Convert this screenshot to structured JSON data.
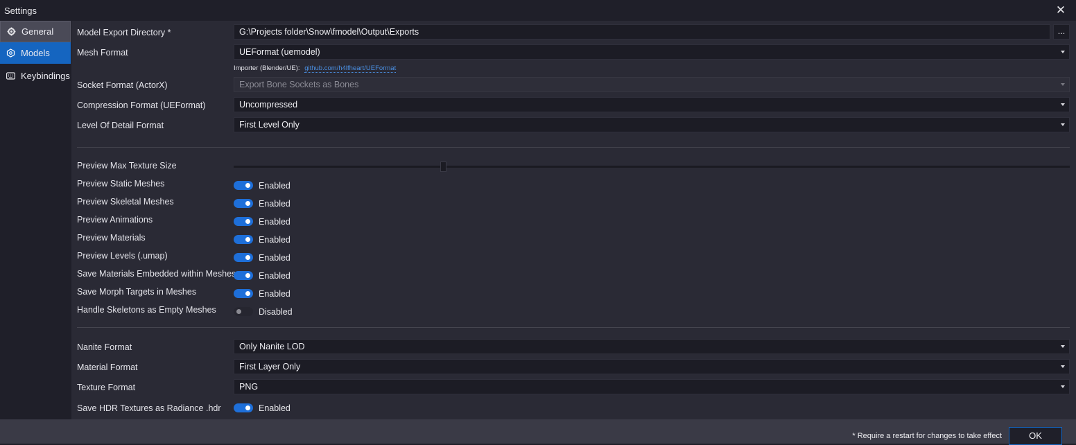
{
  "window": {
    "title": "Settings",
    "close_icon": "close-icon"
  },
  "sidebar": {
    "items": [
      {
        "label": "General",
        "icon": "gear-icon",
        "state": "hover"
      },
      {
        "label": "Models",
        "icon": "cube-icon",
        "state": "selected"
      },
      {
        "label": "Keybindings",
        "icon": "keyboard-icon",
        "state": "normal"
      }
    ]
  },
  "settings": {
    "model_export_directory": {
      "label": "Model Export Directory *",
      "value": "G:\\Projects folder\\Snow\\fmodel\\Output\\Exports",
      "browse_label": "..."
    },
    "mesh_format": {
      "label": "Mesh Format",
      "value": "UEFormat (uemodel)"
    },
    "importer": {
      "label": "Importer (Blender/UE):",
      "link": "github.com/h4lfheart/UEFormat"
    },
    "socket_format": {
      "label": "Socket Format (ActorX)",
      "value": "Export Bone Sockets as Bones"
    },
    "compression_format": {
      "label": "Compression Format (UEFormat)",
      "value": "Uncompressed"
    },
    "lod_format": {
      "label": "Level Of Detail Format",
      "value": "First Level Only"
    },
    "preview_max_texture_size": {
      "label": "Preview Max Texture Size",
      "level": 0.25
    },
    "toggles": [
      {
        "label": "Preview Static Meshes",
        "state": "Enabled"
      },
      {
        "label": "Preview Skeletal Meshes",
        "state": "Enabled"
      },
      {
        "label": "Preview Animations",
        "state": "Enabled"
      },
      {
        "label": "Preview Materials",
        "state": "Enabled"
      },
      {
        "label": "Preview Levels (.umap)",
        "state": "Enabled"
      },
      {
        "label": "Save Materials Embedded within Meshes",
        "state": "Enabled"
      },
      {
        "label": "Save Morph Targets in Meshes",
        "state": "Enabled"
      },
      {
        "label": "Handle Skeletons as Empty Meshes",
        "state": "Disabled"
      }
    ],
    "nanite_format": {
      "label": "Nanite Format",
      "value": "Only Nanite LOD"
    },
    "material_format": {
      "label": "Material Format",
      "value": "First Layer Only"
    },
    "texture_format": {
      "label": "Texture Format",
      "value": "PNG"
    },
    "save_hdr": {
      "label": "Save HDR Textures as Radiance .hdr",
      "state": "Enabled"
    }
  },
  "footer": {
    "note": "* Require a restart for changes to take effect",
    "ok_label": "OK"
  },
  "colors": {
    "accent": "#1565c0",
    "toggle_on": "#1e6fd9",
    "link": "#4a8ee0"
  }
}
